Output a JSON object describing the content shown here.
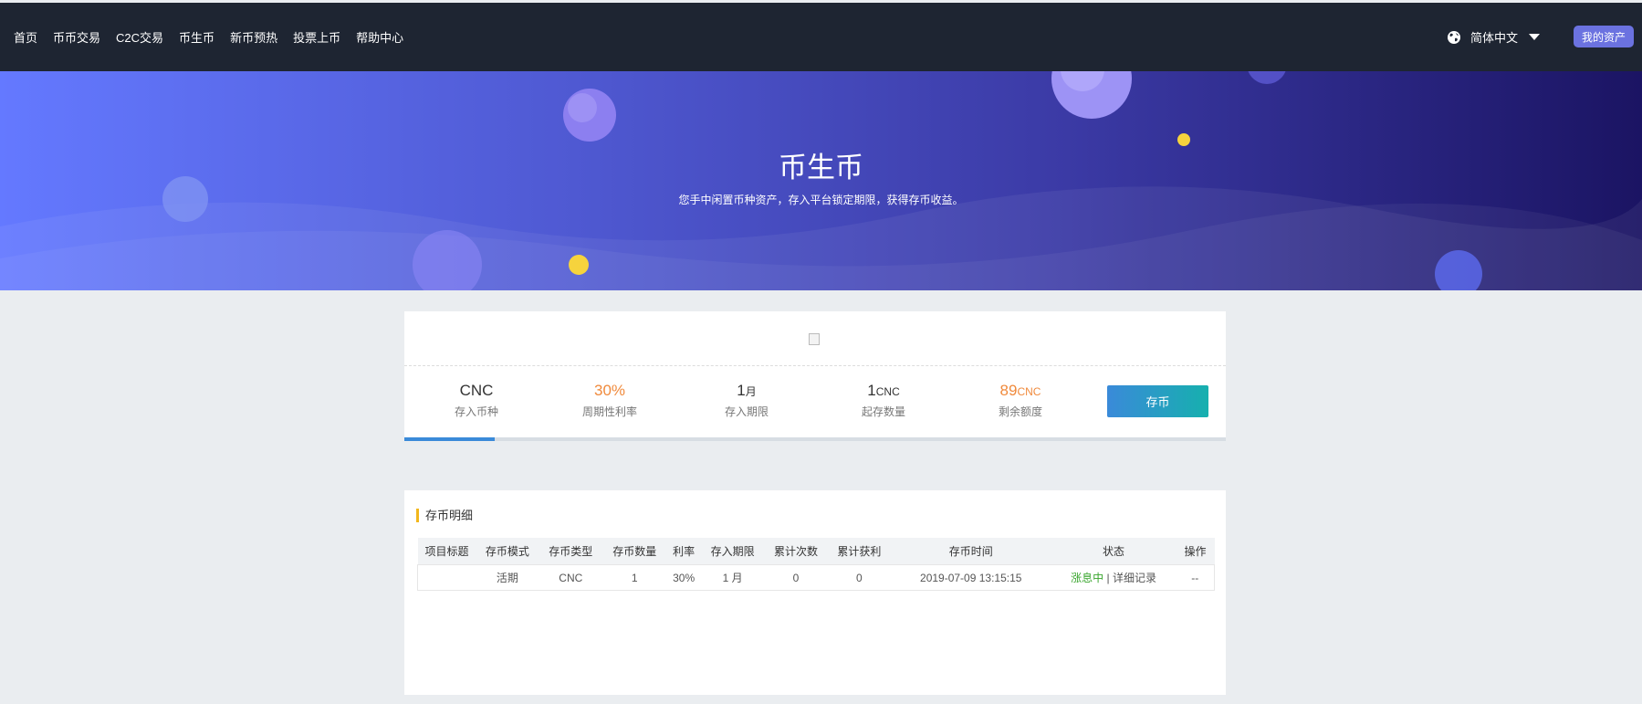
{
  "nav": {
    "items": [
      "首页",
      "币币交易",
      "C2C交易",
      "币生币",
      "新币预热",
      "投票上币",
      "帮助中心"
    ],
    "language": "简体中文",
    "my_assets": "我的资产"
  },
  "hero": {
    "title": "币生币",
    "subtitle": "您手中闲置币种资产，存入平台锁定期限，获得存币收益。"
  },
  "product": {
    "coin": "CNC",
    "coin_label": "存入币种",
    "rate": "30%",
    "rate_label": "周期性利率",
    "term_num": "1",
    "term_unit": "月",
    "term_label": "存入期限",
    "min_num": "1",
    "min_unit": "CNC",
    "min_label": "起存数量",
    "remain_num": "89",
    "remain_unit": "CNC",
    "remain_label": "剩余额度",
    "deposit_button": "存币",
    "progress": 0.11
  },
  "records": {
    "title": "存币明细",
    "columns": [
      "项目标题",
      "存币模式",
      "存币类型",
      "存币数量",
      "利率",
      "存入期限",
      "累计次数",
      "累计获利",
      "存币时间",
      "状态",
      "操作"
    ],
    "rows": [
      {
        "title": "",
        "mode": "活期",
        "type": "CNC",
        "amount": "1",
        "rate": "30%",
        "term": "1 月",
        "count": "0",
        "profit": "0",
        "time": "2019-07-09 13:15:15",
        "status": "涨息中",
        "sep": " | ",
        "detail": "详细记录",
        "action": "--"
      }
    ]
  },
  "colors": {
    "topbar": "#1e2532",
    "accent": "#6b72e0",
    "orange": "#f08a3c",
    "green": "#3aa62f",
    "button_from": "#3a8ad9",
    "button_to": "#16b0ae"
  }
}
